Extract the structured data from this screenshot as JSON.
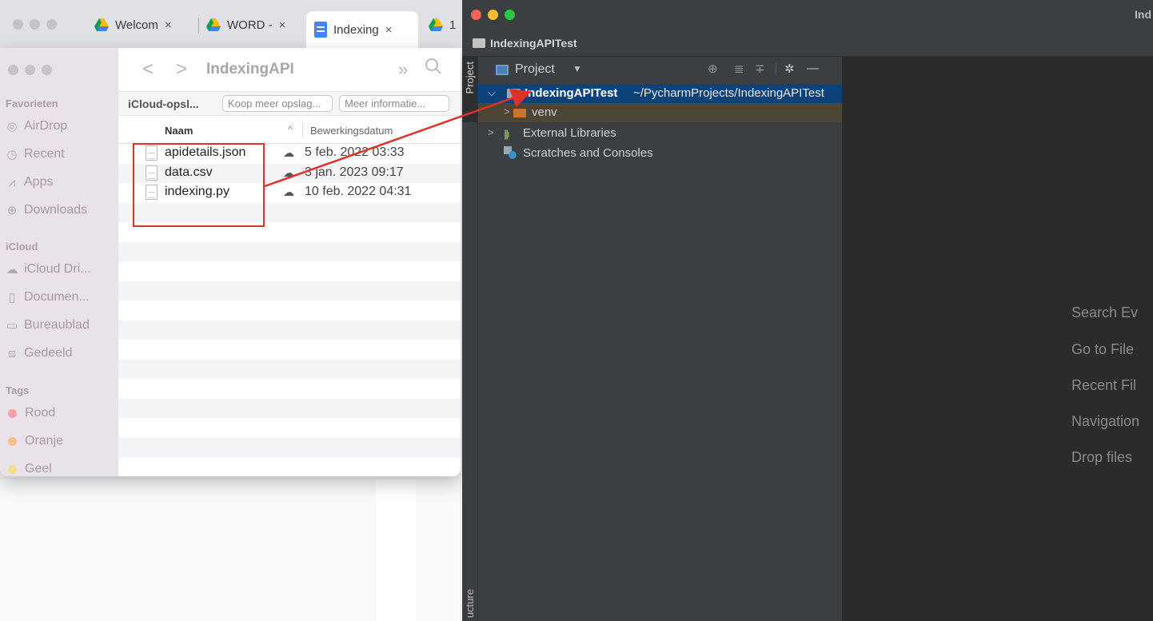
{
  "browser": {
    "tabs": [
      {
        "label": "Welcom",
        "close": "×"
      },
      {
        "label": "WORD -",
        "close": "×"
      },
      {
        "label": "Indexing",
        "close": "×"
      },
      {
        "label": "1"
      }
    ]
  },
  "finder": {
    "title": "IndexingAPI",
    "nav_back": "<",
    "nav_forward": ">",
    "more": "»",
    "sidebar": {
      "favorites_title": "Favorieten",
      "favorites": [
        {
          "label": "AirDrop",
          "icon": "airdrop-icon",
          "glyph": "◎"
        },
        {
          "label": "Recent",
          "icon": "clock-icon",
          "glyph": "◷"
        },
        {
          "label": "Apps",
          "icon": "apps-icon",
          "glyph": "⩘"
        },
        {
          "label": "Downloads",
          "icon": "download-icon",
          "glyph": "⊕"
        }
      ],
      "icloud_title": "iCloud",
      "icloud": [
        {
          "label": "iCloud Dri...",
          "icon": "cloud-icon",
          "glyph": "☁"
        },
        {
          "label": "Documen...",
          "icon": "document-icon",
          "glyph": "▯"
        },
        {
          "label": "Bureaublad",
          "icon": "desktop-icon",
          "glyph": "▭"
        },
        {
          "label": "Gedeeld",
          "icon": "shared-folder-icon",
          "glyph": "⧈"
        }
      ],
      "tags_title": "Tags",
      "tags": [
        {
          "label": "Rood",
          "color": "#f2a3a8"
        },
        {
          "label": "Oranje",
          "color": "#f3c28a"
        },
        {
          "label": "Geel",
          "color": "#f3df8a"
        }
      ]
    },
    "banner": {
      "label": "iCloud-opsl...",
      "buy_button": "Koop meer opslag...",
      "info_button": "Meer informatie..."
    },
    "columns": {
      "name": "Naam",
      "sort_indicator": "^",
      "date": "Bewerkingsdatum"
    },
    "files": [
      {
        "name": "apidetails.json",
        "date": "5 feb. 2022 03:33",
        "status": "☁"
      },
      {
        "name": "data.csv",
        "date": "3 jan. 2023 09:17",
        "status": "☁"
      },
      {
        "name": "indexing.py",
        "date": "10 feb. 2022 04:31",
        "status": "☁"
      }
    ]
  },
  "pycharm": {
    "window_title": "Ind",
    "breadcrumb": "IndexingAPITest",
    "stripe_project": "Project",
    "stripe_structure": "ucture",
    "panel_title": "Project",
    "tree": {
      "root_name": "IndexingAPITest",
      "root_path": "~/PycharmProjects/IndexingAPITest",
      "venv": "venv",
      "libraries": "External Libraries",
      "scratches": "Scratches and Consoles"
    },
    "editor_hints": [
      "Search Ev",
      "Go to File",
      "Recent Fil",
      "Navigation",
      "Drop files"
    ]
  },
  "colors": {
    "annotation_red": "#e0302a",
    "pycharm_bg": "#2b2b2b",
    "tree_selection": "#0d4278"
  }
}
